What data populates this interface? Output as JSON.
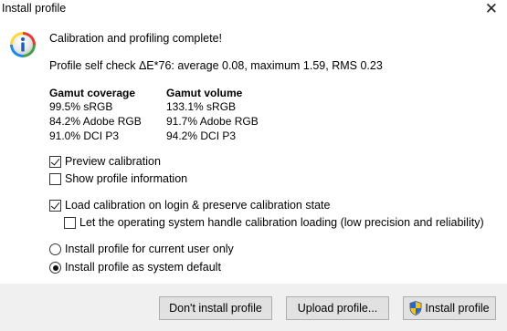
{
  "window": {
    "title": "Install profile",
    "close_glyph": "✕"
  },
  "icons": {
    "info": "info-icon",
    "close": "close-icon",
    "shield": "uac-shield-icon"
  },
  "message": {
    "complete": "Calibration and profiling complete!",
    "self_check": "Profile self check ΔE*76: average 0.08, maximum 1.59, RMS 0.23"
  },
  "gamut": {
    "coverage_header": "Gamut coverage",
    "volume_header": "Gamut volume",
    "coverage": [
      "99.5% sRGB",
      "84.2% Adobe RGB",
      "91.0% DCI P3"
    ],
    "volume": [
      "133.1% sRGB",
      "91.7% Adobe RGB",
      "94.2% DCI P3"
    ]
  },
  "options": {
    "preview_calibration": {
      "label": "Preview calibration",
      "checked": true
    },
    "show_profile_info": {
      "label": "Show profile information",
      "checked": false
    },
    "load_calibration": {
      "label": "Load calibration on login & preserve calibration state",
      "checked": true
    },
    "os_handle_loading": {
      "label": "Let the operating system handle calibration loading (low precision and reliability)",
      "checked": false
    },
    "install_current_user": {
      "label": "Install profile for current user only",
      "selected": false
    },
    "install_system_default": {
      "label": "Install profile as system default",
      "selected": true
    }
  },
  "buttons": {
    "dont_install": "Don't install profile",
    "upload": "Upload profile...",
    "install": "Install profile"
  }
}
